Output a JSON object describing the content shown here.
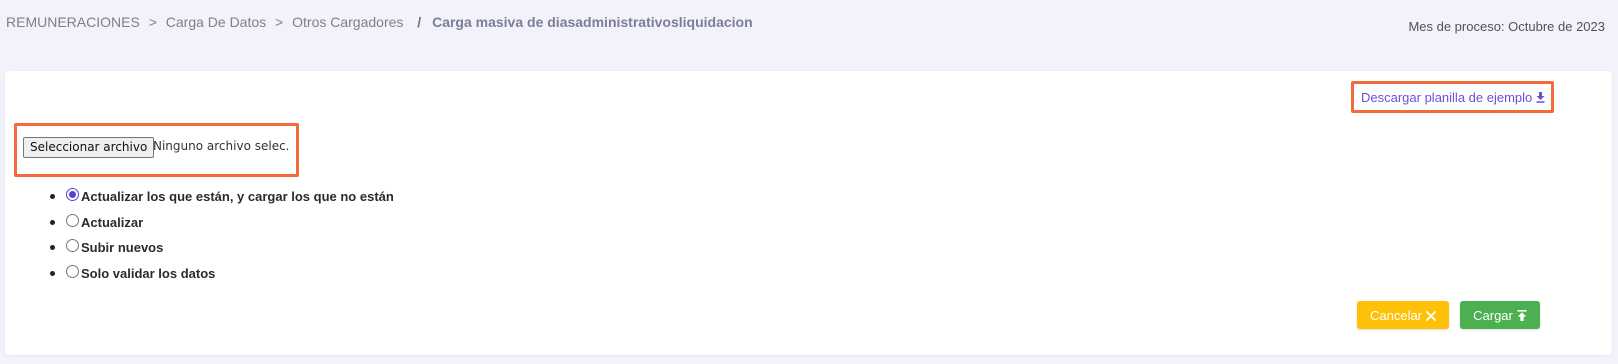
{
  "breadcrumb": {
    "items": [
      "REMUNERACIONES",
      "Carga De Datos",
      "Otros Cargadores"
    ],
    "separator": ">",
    "current_separator": "/",
    "current": "Carga masiva de diasadministrativosliquidacion"
  },
  "process_month": "Mes de proceso: Octubre de 2023",
  "download": {
    "label": "Descargar planilla de ejemplo",
    "icon": "download-icon"
  },
  "file_input": {
    "button_label": "Seleccionar archivo",
    "status": "Ninguno archivo selec."
  },
  "options": [
    {
      "label": "Actualizar los que están, y cargar los que no están",
      "checked": true
    },
    {
      "label": "Actualizar",
      "checked": false
    },
    {
      "label": "Subir nuevos",
      "checked": false
    },
    {
      "label": "Solo validar los datos",
      "checked": false
    }
  ],
  "buttons": {
    "cancel_label": "Cancelar",
    "cancel_icon": "close-icon",
    "upload_label": "Cargar",
    "upload_icon": "upload-icon"
  },
  "colors": {
    "highlight": "#f26b38",
    "link": "#6b4fd8",
    "cancel": "#ffc107",
    "upload": "#4caf50",
    "radio_checked": "#5b3fd0"
  }
}
